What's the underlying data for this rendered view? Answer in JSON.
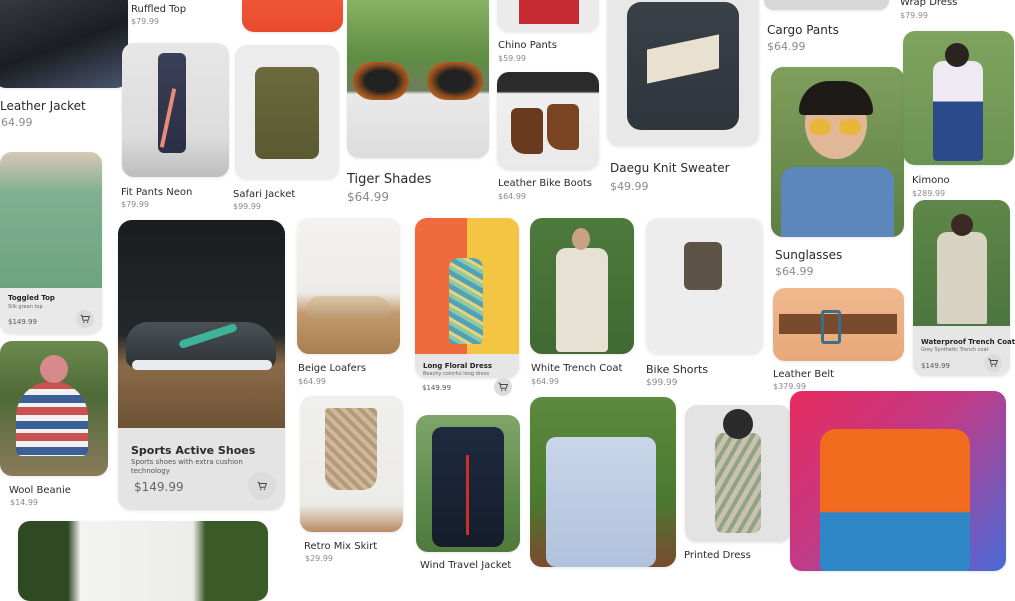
{
  "products": {
    "ruffled_top": {
      "name": "Ruffled Top",
      "price": "$79.99"
    },
    "leather_jacket": {
      "name": "Leather Jacket",
      "price": "$64.99"
    },
    "fit_pants": {
      "name": "Fit Pants Neon",
      "price": "$79.99"
    },
    "safari_jacket": {
      "name": "Safari Jacket",
      "price": "$99.99"
    },
    "tiger_shades": {
      "name": "Tiger Shades",
      "price": "$64.99"
    },
    "chino_pants": {
      "name": "Chino Pants",
      "price": "$59.99"
    },
    "leather_boots": {
      "name": "Leather Bike Boots",
      "price": "$64.99"
    },
    "daegu_sweater": {
      "name": "Daegu Knit Sweater",
      "price": "$49.99"
    },
    "cargo_pants": {
      "name": "Cargo Pants",
      "price": "$64.99"
    },
    "wrap_dress": {
      "name": "Wrap Dress",
      "price": "$79.99"
    },
    "kimono": {
      "name": "Kimono",
      "price": "$289.99"
    },
    "sunglasses": {
      "name": "Sunglasses",
      "price": "$64.99"
    },
    "toggled_top": {
      "name": "Toggled Top",
      "sub": "Silk green top",
      "price": "$149.99"
    },
    "sports_shoes": {
      "name": "Sports Active Shoes",
      "sub": "Sports shoes with extra cushion technology",
      "price": "$149.99"
    },
    "beige_loafers": {
      "name": "Beige Loafers",
      "price": "$64.99"
    },
    "floral_dress": {
      "name": "Long Floral Dress",
      "sub": "Beachy colorful long dress",
      "price": "$149.99"
    },
    "white_trench": {
      "name": "White Trench Coat",
      "price": "$64.99"
    },
    "bike_shorts": {
      "name": "Bike Shorts",
      "price": "$99.99"
    },
    "leather_belt": {
      "name": "Leather Belt",
      "price": "$379.99"
    },
    "waterproof_trench": {
      "name": "Waterproof Trench Coat",
      "sub": "Grey Synthetic Trench coat",
      "price": "$149.99"
    },
    "wool_beanie": {
      "name": "Wool Beanie",
      "price": "$14.99"
    },
    "retro_skirt": {
      "name": "Retro Mix Skirt",
      "price": "$29.99"
    },
    "wind_jacket": {
      "name": "Wind Travel Jacket",
      "price": ""
    },
    "printed_dress": {
      "name": "Printed Dress",
      "price": ""
    }
  },
  "colors": {
    "panel": "#e9e9e9",
    "text": "#1d1d1f",
    "muted": "#8a8a8a"
  },
  "icons": {
    "cart": "cart-icon"
  }
}
